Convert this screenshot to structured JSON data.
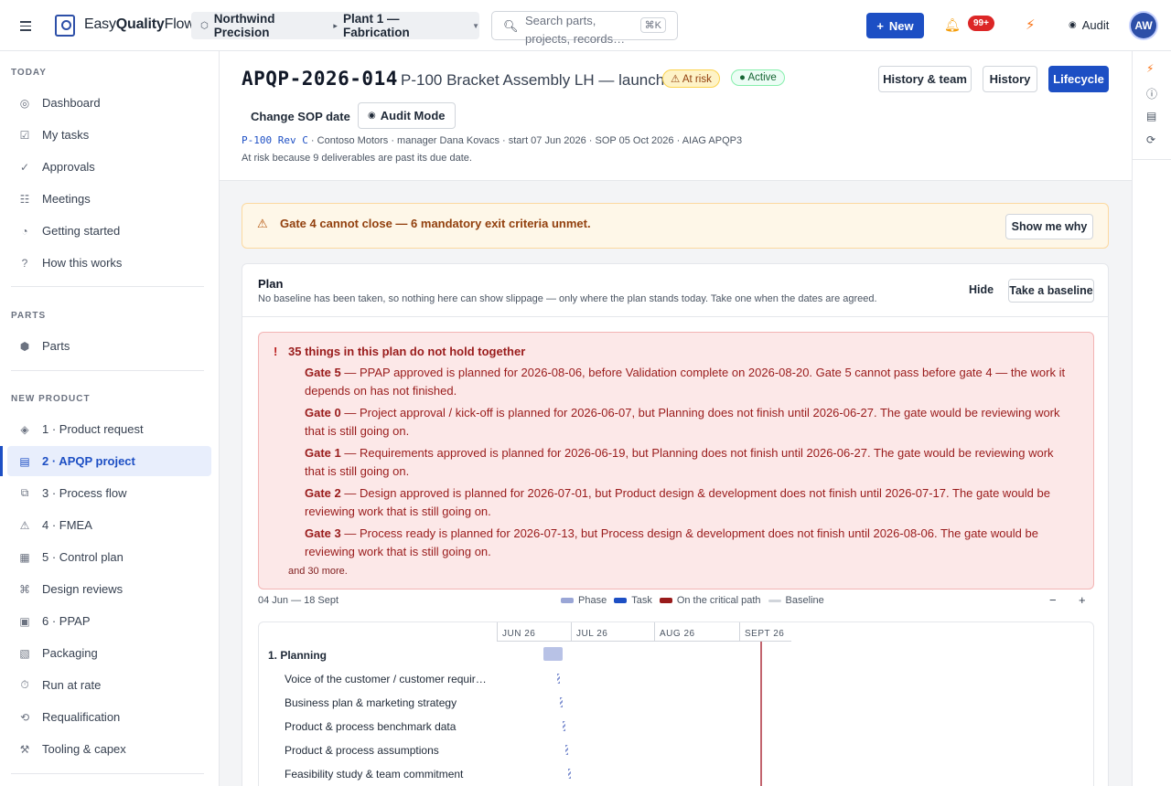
{
  "topbar": {
    "brand_plain": "Easy",
    "brand_bold": "Quality",
    "brand_end": "Flow",
    "context_org": "Northwind Precision",
    "context_site": "Plant 1 — Fabrication",
    "search_placeholder": "Search parts, projects, records…",
    "search_shortcut": "⌘K",
    "new_label": "New",
    "notif_count": "99+",
    "audit_label": "Audit",
    "avatar_initials": "AW"
  },
  "sidebar": {
    "sections": [
      {
        "title": "TODAY",
        "items": [
          {
            "icon": "dashboard-icon",
            "glyph": "◎",
            "label": "Dashboard"
          },
          {
            "icon": "tasks-icon",
            "glyph": "☑",
            "label": "My tasks"
          },
          {
            "icon": "approvals-icon",
            "glyph": "✓",
            "label": "Approvals"
          },
          {
            "icon": "meetings-icon",
            "glyph": "☷",
            "label": "Meetings"
          },
          {
            "icon": "getting-started-icon",
            "glyph": "◔",
            "label": "Getting started"
          },
          {
            "icon": "help-icon",
            "glyph": "?",
            "label": "How this works"
          }
        ]
      },
      {
        "title": "PARTS",
        "items": [
          {
            "icon": "parts-icon",
            "glyph": "⬢",
            "label": "Parts"
          }
        ]
      },
      {
        "title": "NEW PRODUCT",
        "items": [
          {
            "icon": "product-request-icon",
            "glyph": "◈",
            "label": "1 · Product request"
          },
          {
            "icon": "apqp-project-icon",
            "glyph": "▤",
            "label": "2 · APQP project",
            "active": true
          },
          {
            "icon": "process-flow-icon",
            "glyph": "⧉",
            "label": "3 · Process flow"
          },
          {
            "icon": "fmea-icon",
            "glyph": "⚠",
            "label": "4 · FMEA"
          },
          {
            "icon": "control-plan-icon",
            "glyph": "▦",
            "label": "5 · Control plan"
          },
          {
            "icon": "design-reviews-icon",
            "glyph": "⌘",
            "label": "Design reviews"
          },
          {
            "icon": "ppap-icon",
            "glyph": "▣",
            "label": "6 · PPAP"
          },
          {
            "icon": "packaging-icon",
            "glyph": "▧",
            "label": "Packaging"
          },
          {
            "icon": "run-at-rate-icon",
            "glyph": "⏱",
            "label": "Run at rate"
          },
          {
            "icon": "requalification-icon",
            "glyph": "⟲",
            "label": "Requalification"
          },
          {
            "icon": "tooling-icon",
            "glyph": "⚒",
            "label": "Tooling & capex"
          }
        ]
      }
    ]
  },
  "header": {
    "project_id": "APQP-2026-014",
    "project_title": "P-100 Bracket Assembly LH — launch",
    "risk_pill": "At risk",
    "status_pill": "Active",
    "history_team_label": "History & team",
    "history_label": "History",
    "lifecycle_label": "Lifecycle",
    "change_sop_label": "Change SOP date",
    "audit_mode_label": "Audit Mode",
    "part_rev": "P-100 Rev C",
    "meta_rest": " · Contoso Motors · manager Dana Kovacs · start 07 Jun 2026 · SOP 05 Oct 2026 · AIAG APQP3",
    "risk_reason": "At risk because 9 deliverables are past its due date."
  },
  "gate_banner": {
    "message": "Gate 4 cannot close — 6 mandatory exit criteria unmet.",
    "button": "Show me why"
  },
  "plan": {
    "title": "Plan",
    "subtitle": "No baseline has been taken, so nothing here can show slippage — only where the plan stands today. Take one when the dates are agreed.",
    "hide_label": "Hide",
    "baseline_label": "Take a baseline",
    "issues_title": "35 things in this plan do not hold together",
    "issues": [
      {
        "gate": "Gate 5",
        "text": " — PPAP approved is planned for 2026-08-06, before Validation complete on 2026-08-20. Gate 5 cannot pass before gate 4 — the work it depends on has not finished."
      },
      {
        "gate": "Gate 0",
        "text": " — Project approval / kick-off is planned for 2026-06-07, but Planning does not finish until 2026-06-27. The gate would be reviewing work that is still going on."
      },
      {
        "gate": "Gate 1",
        "text": " — Requirements approved is planned for 2026-06-19, but Planning does not finish until 2026-06-27. The gate would be reviewing work that is still going on."
      },
      {
        "gate": "Gate 2",
        "text": " — Design approved is planned for 2026-07-01, but Product design & development does not finish until 2026-07-17. The gate would be reviewing work that is still going on."
      },
      {
        "gate": "Gate 3",
        "text": " — Process ready is planned for 2026-07-13, but Process design & development does not finish until 2026-08-06. The gate would be reviewing work that is still going on."
      }
    ],
    "issues_more": "and 30 more.",
    "range": "04 Jun — 18 Sept",
    "legend": [
      {
        "label": "Phase",
        "color": "#9aa6d6"
      },
      {
        "label": "Task",
        "color": "#1d4fc4"
      },
      {
        "label": "On the critical path",
        "color": "#991b1b"
      },
      {
        "label": "Baseline",
        "color": "#d1d5db"
      }
    ],
    "zoom_out": "−",
    "zoom_in": "+"
  },
  "gantt": {
    "months": [
      "JUN 26",
      "JUL 26",
      "AUG 26",
      "SEPT 26"
    ],
    "rows": [
      {
        "label": "1. Planning",
        "type": "phase"
      },
      {
        "label": "Voice of the customer / customer requir…",
        "type": "task"
      },
      {
        "label": "Business plan & marketing strategy",
        "type": "task"
      },
      {
        "label": "Product & process benchmark data",
        "type": "task"
      },
      {
        "label": "Product & process assumptions",
        "type": "task"
      },
      {
        "label": "Feasibility study & team commitment",
        "type": "task"
      }
    ]
  }
}
